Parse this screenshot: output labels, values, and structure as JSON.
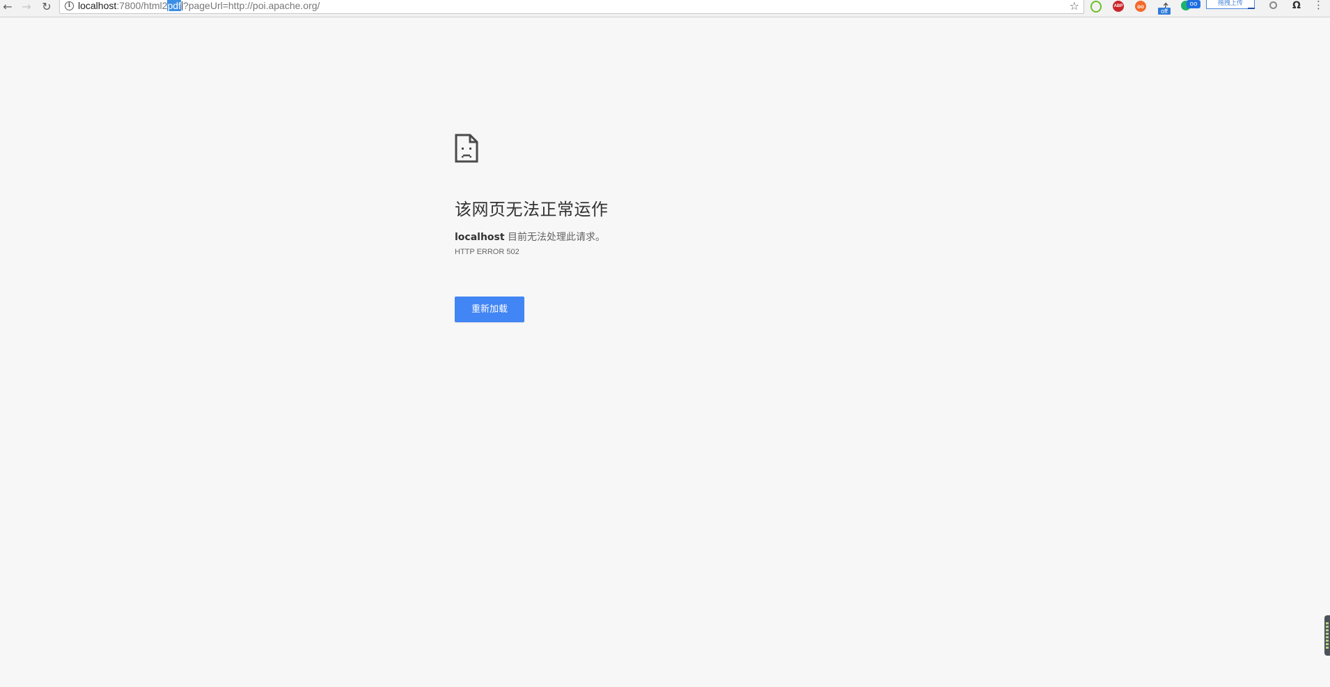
{
  "browser": {
    "url": {
      "host": "localhost",
      "port_path": ":7800/html2",
      "selected": "pdf",
      "rest": "?pageUrl=http://poi.apache.org/"
    },
    "nav": {
      "back_icon": "←",
      "forward_icon": "→",
      "reload_icon": "↻"
    },
    "extensions": {
      "abp_label": "ABP",
      "glasses_label": "oo",
      "off_badge": "off",
      "blue_ext_label": "oo",
      "upload_label": "拖拽上传"
    }
  },
  "error_page": {
    "title": "该网页无法正常运作",
    "host": "localhost",
    "description": " 目前无法处理此请求。",
    "error_code": "HTTP ERROR 502",
    "reload_label": "重新加载"
  },
  "colors": {
    "page_background": "#f7f7f7",
    "button_blue": "#4285f4",
    "url_selection": "#3a8ee6"
  }
}
